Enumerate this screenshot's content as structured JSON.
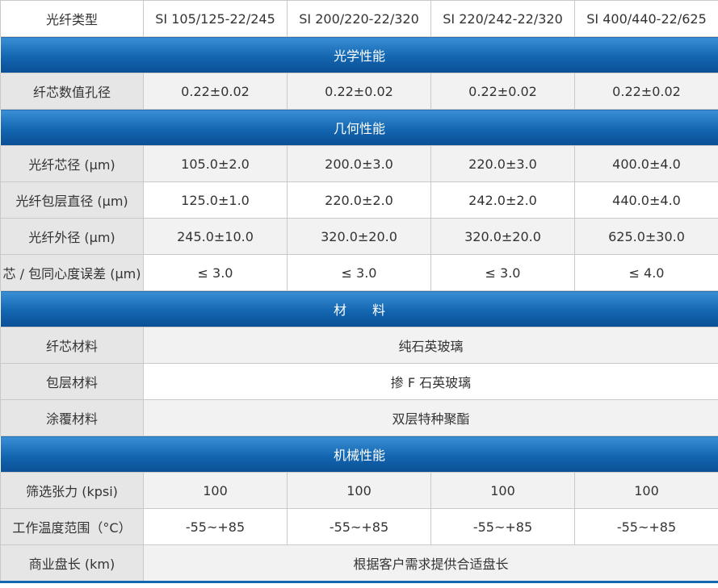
{
  "header": {
    "label": "光纤类型",
    "types": [
      "SI 105/125-22/245",
      "SI 200/220-22/320",
      "SI 220/242-22/320",
      "SI 400/440-22/625"
    ]
  },
  "sections": {
    "optical": "光学性能",
    "geometric": "几何性能",
    "material": "材　　料",
    "mechanical": "机械性能"
  },
  "rows": {
    "na": {
      "label": "纤芯数值孔径",
      "values": [
        "0.22±0.02",
        "0.22±0.02",
        "0.22±0.02",
        "0.22±0.02"
      ]
    },
    "core_dia": {
      "label": "光纤芯径 (μm)",
      "values": [
        "105.0±2.0",
        "200.0±3.0",
        "220.0±3.0",
        "400.0±4.0"
      ]
    },
    "clad_dia": {
      "label": "光纤包层直径 (μm)",
      "values": [
        "125.0±1.0",
        "220.0±2.0",
        "242.0±2.0",
        "440.0±4.0"
      ]
    },
    "outer_dia": {
      "label": "光纤外径 (μm)",
      "values": [
        "245.0±10.0",
        "320.0±20.0",
        "320.0±20.0",
        "625.0±30.0"
      ]
    },
    "concentricity": {
      "label": "芯 / 包同心度误差 (μm)",
      "values": [
        "≤ 3.0",
        "≤ 3.0",
        "≤ 3.0",
        "≤ 4.0"
      ]
    },
    "core_material": {
      "label": "纤芯材料",
      "value": "纯石英玻璃"
    },
    "clad_material": {
      "label": "包层材料",
      "value": "掺 F 石英玻璃"
    },
    "coat_material": {
      "label": "涂覆材料",
      "value": "双层特种聚酯"
    },
    "proof_test": {
      "label": "筛选张力 (kpsi)",
      "values": [
        "100",
        "100",
        "100",
        "100"
      ]
    },
    "temp_range": {
      "label": "工作温度范围（°C）",
      "values": [
        "-55~+85",
        "-55~+85",
        "-55~+85",
        "-55~+85"
      ]
    },
    "length": {
      "label": "商业盘长 (km)",
      "value": "根据客户需求提供合适盘长"
    }
  }
}
